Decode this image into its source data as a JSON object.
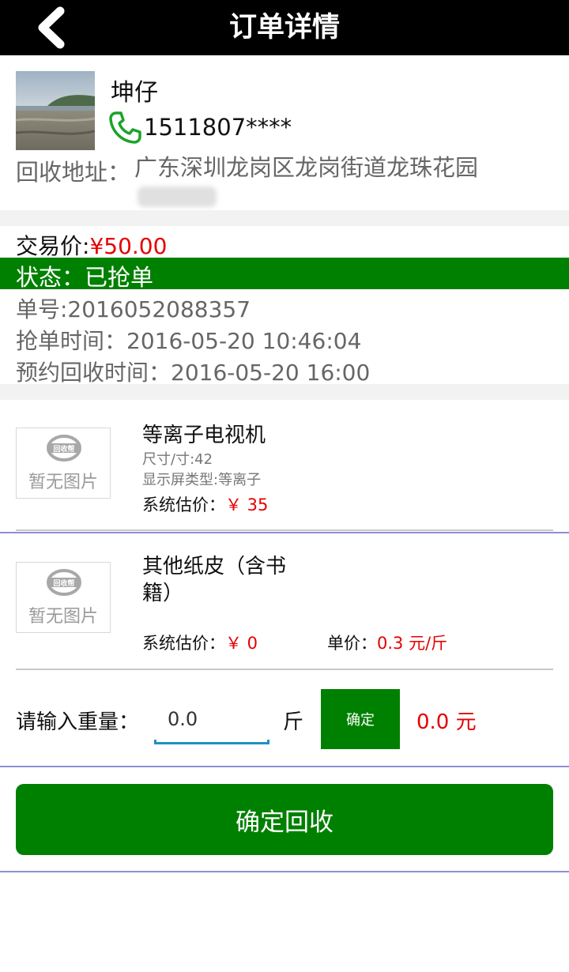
{
  "header": {
    "title": "订单详情",
    "back_icon": "chevron-left-icon"
  },
  "customer": {
    "name": "坤仔",
    "phone": "1511807****",
    "phone_icon": "phone-icon",
    "address_label": "回收地址：",
    "address": "广东深圳龙岗区龙岗街道龙珠花园"
  },
  "order": {
    "price_label": "交易价:",
    "price": "¥50.00",
    "status": "状态：已抢单",
    "order_no": "单号:2016052088357",
    "grab_time": "抢单时间：2016-05-20 10:46:04",
    "appointment_time": "预约回收时间：2016-05-20 16:00"
  },
  "items": [
    {
      "no_image": "暂无图片",
      "logo_text": "回收帮",
      "name": "等离子电视机",
      "attr1": "尺寸/寸:42",
      "attr2": "显示屏类型:等离子",
      "est_label": "系统估价：",
      "est_value": "￥ 35"
    },
    {
      "no_image": "暂无图片",
      "logo_text": "回收帮",
      "name": "其他纸皮（含书籍）",
      "est_label": "系统估价：",
      "est_value": "￥ 0",
      "unit_price_label": "单价：",
      "unit_price_value": "0.3  元/斤"
    }
  ],
  "weight": {
    "label": "请输入重量：",
    "value": "0.0",
    "unit": "斤",
    "confirm_label": "确定",
    "total": "0.0  元"
  },
  "submit": {
    "label": "确定回收"
  },
  "colors": {
    "accent_green": "#008000",
    "price_red": "#e60000",
    "divider_purple": "#8e8ed6"
  }
}
